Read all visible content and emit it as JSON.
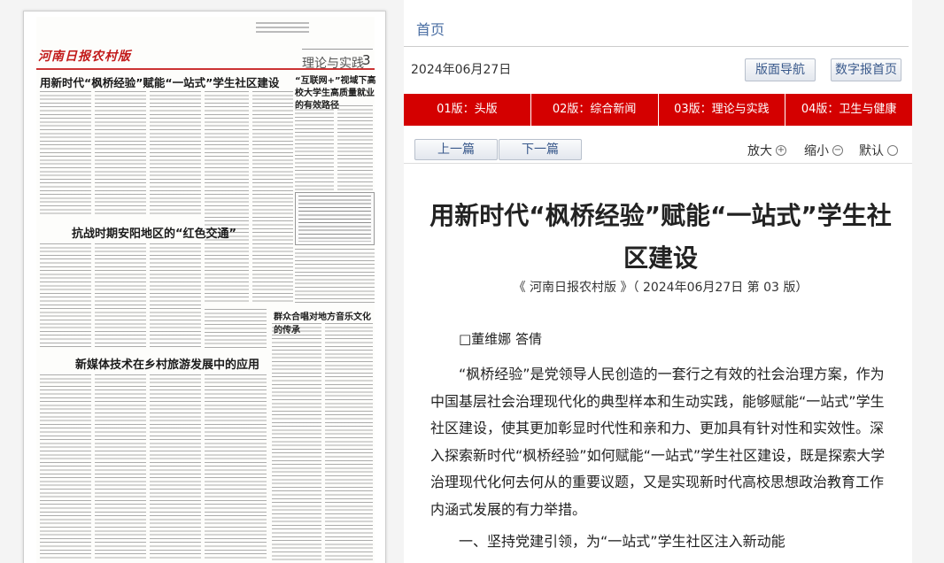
{
  "newspaper": {
    "logo": "河南日报农村版",
    "section": "理论与实践",
    "page_num": "3",
    "headlines": [
      "用新时代“枫桥经验”赋能“一站式”学生社区建设",
      "“互联网+”视域下高校大学生高质量就业的有效路径",
      "抗战时期安阳地区的“红色交通”",
      "新媒体技术在乡村旅游发展中的应用",
      "群众合唱对地方音乐文化的传承"
    ]
  },
  "reader": {
    "home_link": "首页",
    "date": "2024年06月27日",
    "layout_nav_button": "版面导航",
    "digital_home_button": "数字报首页",
    "sections": [
      "01版：头版",
      "02版：综合新闻",
      "03版：理论与实践",
      "04版：卫生与健康"
    ],
    "prev_button": "上一篇",
    "next_button": "下一篇",
    "zoom_in": "放大",
    "zoom_out": "缩小",
    "zoom_default": "默认"
  },
  "article": {
    "title": "用新时代“枫桥经验”赋能“一站式”学生社区建设",
    "source": "《 河南日报农村版 》（ 2024年06月27日 第 03 版）",
    "author": "□董维娜 答倩",
    "paragraph": "“枫桥经验”是党领导人民创造的一套行之有效的社会治理方案，作为中国基层社会治理现代化的典型样本和生动实践，能够赋能“一站式”学生社区建设，使其更加彰显时代性和亲和力、更加具有针对性和实效性。深入探索新时代“枫桥经验”如何赋能“一站式”学生社区建设，既是探索大学治理现代化何去何从的重要议题，又是实现新时代高校思想政治教育工作内涵式发展的有力举措。",
    "subhead": "一、坚持党建引领，为“一站式”学生社区注入新动能"
  }
}
